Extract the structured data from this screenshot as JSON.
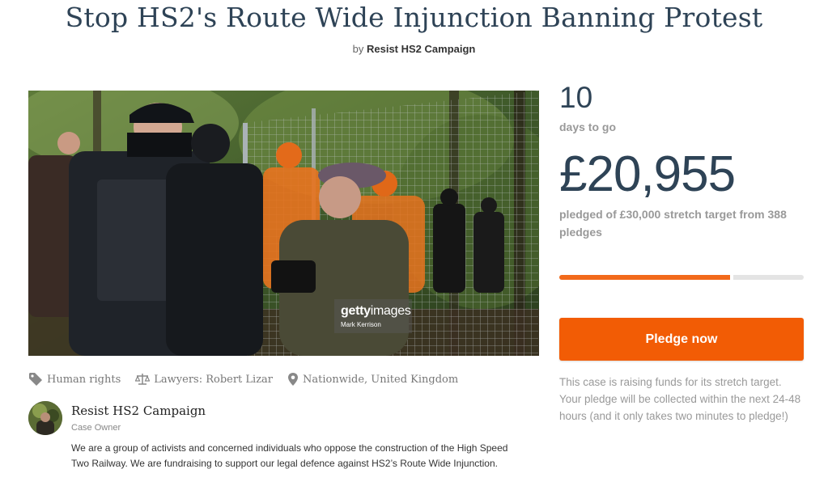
{
  "campaign": {
    "title": "Stop HS2's Route Wide Injunction Banning Protest",
    "by_prefix": "by",
    "by_name": "Resist HS2 Campaign"
  },
  "photo": {
    "watermark_brand_bold": "getty",
    "watermark_brand_light": "images",
    "watermark_credit": "Mark Kerrison"
  },
  "meta": {
    "category": "Human rights",
    "lawyers": "Lawyers: Robert Lizar",
    "location": "Nationwide, United Kingdom"
  },
  "owner": {
    "name": "Resist HS2 Campaign",
    "role": "Case Owner",
    "description": "We are a group of activists and concerned individuals who oppose the construction of the High Speed Two Railway. We are fundraising to support our legal defence against HS2’s Route Wide Injunction."
  },
  "funding": {
    "days_left": "10",
    "days_label": "days to go",
    "amount": "£20,955",
    "pledged_text": "pledged of £30,000 stretch target from 388 pledges",
    "progress_fraction": 0.699
  },
  "pledge_button": {
    "label": "Pledge now"
  },
  "stretch_note": "This case is raising funds for its stretch target. Your pledge will be collected within the next 24-48 hours (and it only takes two minutes to pledge!)",
  "colors": {
    "title": "#2e4356",
    "accent": "#f25c05",
    "progress_track": "#e4e4e4"
  },
  "icons": [
    "tag-icon",
    "scales-icon",
    "location-pin-icon"
  ]
}
